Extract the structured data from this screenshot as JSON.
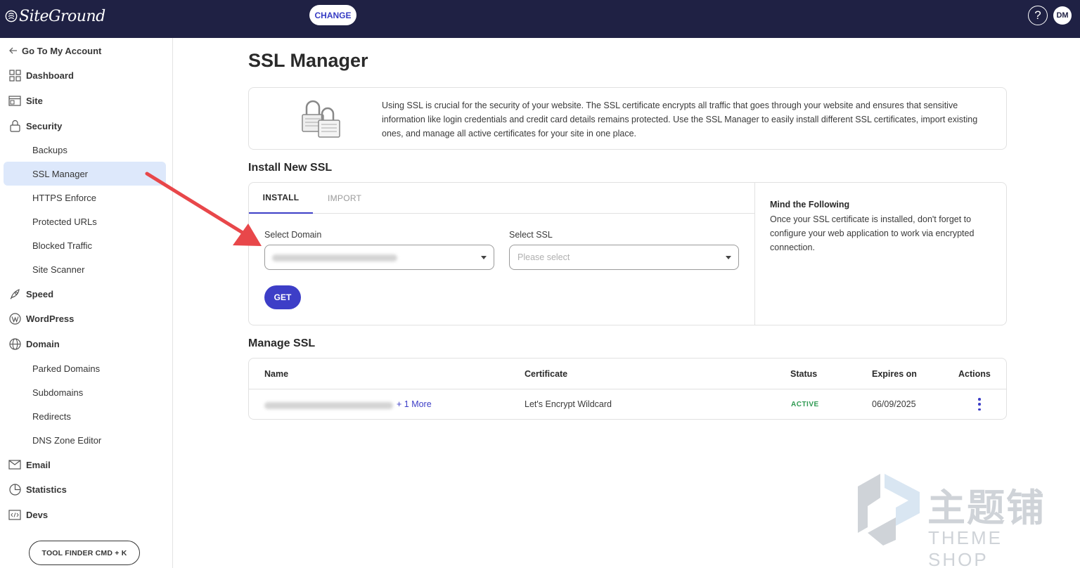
{
  "topbar": {
    "logo": "SiteGround",
    "change_label": "CHANGE",
    "help_label": "?",
    "avatar_initials": "DM"
  },
  "sidebar": {
    "back_label": "Go To My Account",
    "items": [
      {
        "label": "Dashboard",
        "icon": "dashboard-icon",
        "level": "top"
      },
      {
        "label": "Site",
        "icon": "site-icon",
        "level": "top"
      },
      {
        "label": "Security",
        "icon": "lock-icon",
        "level": "top"
      },
      {
        "label": "Backups",
        "level": "sub"
      },
      {
        "label": "SSL Manager",
        "level": "sub",
        "active": true
      },
      {
        "label": "HTTPS Enforce",
        "level": "sub"
      },
      {
        "label": "Protected URLs",
        "level": "sub"
      },
      {
        "label": "Blocked Traffic",
        "level": "sub"
      },
      {
        "label": "Site Scanner",
        "level": "sub"
      },
      {
        "label": "Speed",
        "icon": "rocket-icon",
        "level": "top"
      },
      {
        "label": "WordPress",
        "icon": "wordpress-icon",
        "level": "top"
      },
      {
        "label": "Domain",
        "icon": "globe-icon",
        "level": "top"
      },
      {
        "label": "Parked Domains",
        "level": "sub"
      },
      {
        "label": "Subdomains",
        "level": "sub"
      },
      {
        "label": "Redirects",
        "level": "sub"
      },
      {
        "label": "DNS Zone Editor",
        "level": "sub"
      },
      {
        "label": "Email",
        "icon": "envelope-icon",
        "level": "top"
      },
      {
        "label": "Statistics",
        "icon": "pie-chart-icon",
        "level": "top"
      },
      {
        "label": "Devs",
        "icon": "code-icon",
        "level": "top"
      }
    ],
    "tool_finder_label": "TOOL FINDER CMD + K"
  },
  "main": {
    "title": "SSL Manager",
    "info_text": "Using SSL is crucial for the security of your website. The SSL certificate encrypts all traffic that goes through your website and ensures that sensitive information like login credentials and credit card details remains protected. Use the SSL Manager to easily install different SSL certificates, import existing ones, and manage all active certificates for your site in one place.",
    "install": {
      "heading": "Install New SSL",
      "tabs": [
        "INSTALL",
        "IMPORT"
      ],
      "select_domain_label": "Select Domain",
      "select_ssl_label": "Select SSL",
      "select_ssl_placeholder": "Please select",
      "get_label": "GET",
      "mind_title": "Mind the Following",
      "mind_text": "Once your SSL certificate is installed, don't forget to configure your web application to work via encrypted connection."
    },
    "manage": {
      "heading": "Manage SSL",
      "columns": [
        "Name",
        "Certificate",
        "Status",
        "Expires on",
        "Actions"
      ],
      "rows": [
        {
          "more": "+ 1 More",
          "certificate": "Let's Encrypt Wildcard",
          "status": "ACTIVE",
          "expires": "06/09/2025"
        }
      ]
    }
  },
  "watermark": {
    "cn": "主题铺",
    "en": "THEME SHOP"
  },
  "colors": {
    "topbar": "#1f2144",
    "accent": "#3d3ec7",
    "active_bg": "#dde8fb",
    "status_active": "#2f9a52",
    "arrow": "#e8474a"
  }
}
